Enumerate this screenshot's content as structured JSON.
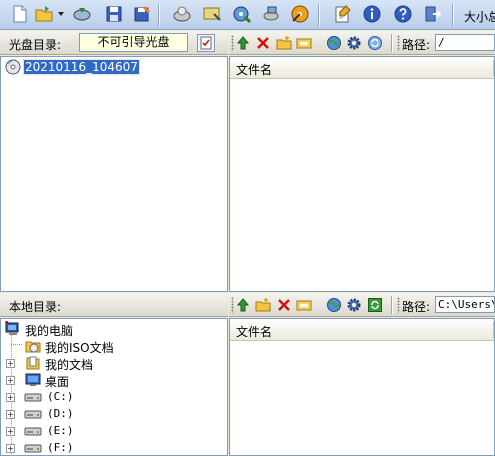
{
  "toolbar": {
    "items": [
      "new-icon",
      "open-icon",
      "extract-icon",
      "save-icon",
      "save-as-icon",
      "burn-icon",
      "mount-icon",
      "compress-icon",
      "convert-icon",
      "make-iso-icon",
      "properties-icon",
      "info-icon",
      "help-icon",
      "exit-icon"
    ],
    "size_label": "大小总"
  },
  "disc_panel": {
    "label": "光盘目录:",
    "boot_value": "不可引导光盘",
    "path_label": "路径:",
    "path_value": "/",
    "column_name": "文件名",
    "tree": [
      {
        "label": "20210116_104607",
        "icon": "disc-icon",
        "selected": true
      }
    ]
  },
  "local_panel": {
    "label": "本地目录:",
    "path_label": "路径:",
    "path_value": "C:\\Users\\",
    "column_name": "文件名",
    "tree": [
      {
        "label": "我的电脑",
        "icon": "computer-icon"
      },
      {
        "label": "我的ISO文档",
        "icon": "iso-folder-icon"
      },
      {
        "label": "我的文档",
        "icon": "documents-icon"
      },
      {
        "label": "桌面",
        "icon": "desktop-icon"
      },
      {
        "label": "(C:)",
        "icon": "drive-icon"
      },
      {
        "label": "(D:)",
        "icon": "drive-icon"
      },
      {
        "label": "(E:)",
        "icon": "drive-icon"
      },
      {
        "label": "(F:)",
        "icon": "drive-icon"
      }
    ]
  },
  "colors": {
    "toolbar_top": "#d7e4f6",
    "toolbar_bottom": "#b9cdea",
    "panel_bg": "#ece9d8",
    "selection": "#316ac5",
    "boot_field_bg": "#ffffe1"
  }
}
